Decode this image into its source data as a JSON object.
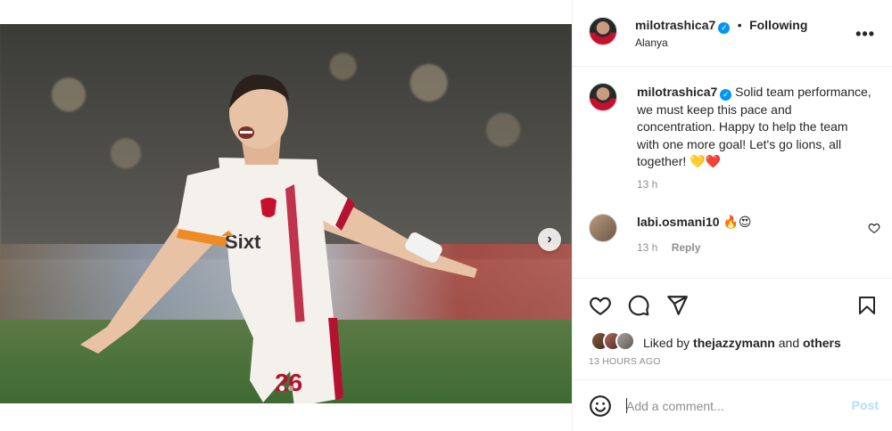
{
  "post": {
    "author": "milotrashica7",
    "separator": "•",
    "follow_state": "Following",
    "location": "Alanya",
    "more_icon": "more-horizontal-icon"
  },
  "media": {
    "carousel_dots": 2,
    "active_dot": 0
  },
  "caption": {
    "author": "milotrashica7",
    "text": "Solid team performance, we must keep this pace and concentration. Happy to help the team with one more goal! Let's go lions, all together! 💛❤️",
    "time": "13 h"
  },
  "comments": [
    {
      "author": "labi.osmani10",
      "text": "🔥😍",
      "time": "13 h",
      "reply_label": "Reply"
    }
  ],
  "likes": {
    "prefix": "Liked by",
    "user": "thejazzymann",
    "conjunction": "and",
    "others": "others",
    "time_ago": "13 HOURS AGO"
  },
  "comment_box": {
    "placeholder": "Add a comment...",
    "post_label": "Post"
  },
  "colors": {
    "accent": "#0095f6",
    "post_disabled": "#b2dffc",
    "muted": "#8e8e8e",
    "heart_red": "#ed4956",
    "galatasaray_red": "#c8102e"
  }
}
